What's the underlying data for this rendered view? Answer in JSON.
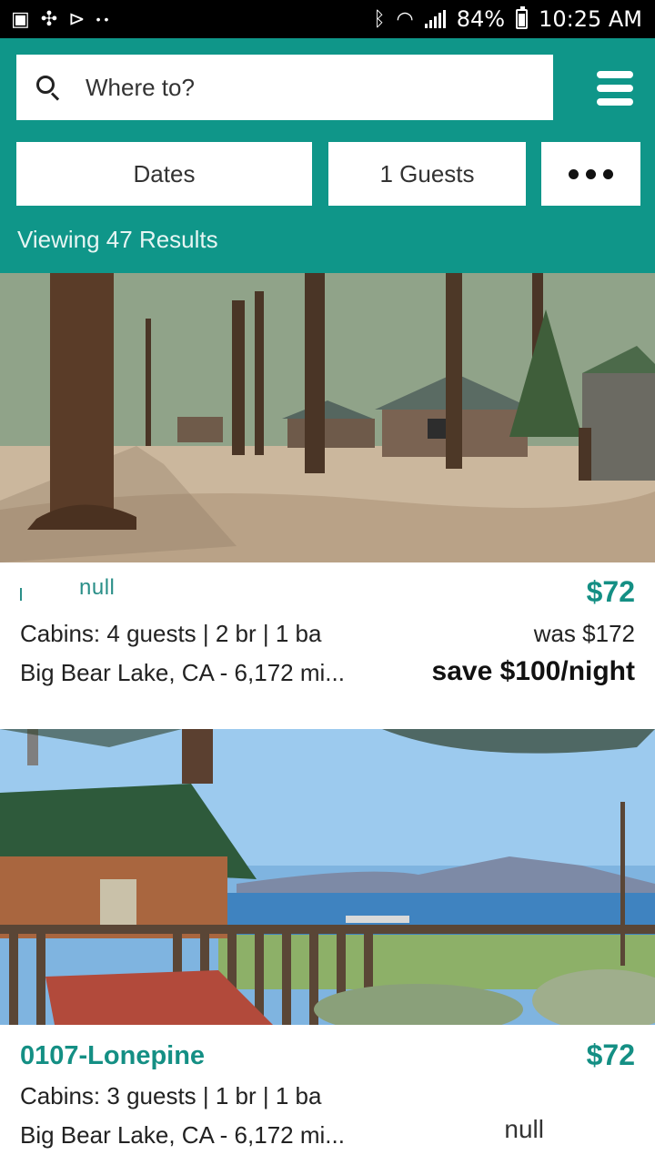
{
  "status_bar": {
    "left_icons": [
      "image-icon",
      "fan-icon",
      "play-icon",
      "dots-icon"
    ],
    "battery_percent": "84%",
    "time": "10:25 AM"
  },
  "header": {
    "search": {
      "placeholder": "Where to?"
    },
    "filters": {
      "dates_label": "Dates",
      "guests_label": "1 Guests",
      "more_label": "•••"
    },
    "results_text": "Viewing 47 Results",
    "background_color": "#0f9689"
  },
  "listings": [
    {
      "title": "null",
      "price": "$72",
      "meta": "Cabins: 4 guests | 2 br | 1 ba",
      "location": "Big Bear Lake, CA - 6,172 mi...",
      "was_price": "was $172",
      "savings": "save $100/night",
      "photo": "cabins-among-pine-trees"
    },
    {
      "title": "0107-Lonepine",
      "price": "$72",
      "meta": "Cabins: 3 guests | 1 br | 1 ba",
      "location": "Big Bear Lake, CA - 6,172 mi...",
      "extra": "null",
      "photo": "cabin-deck-lake-view"
    }
  ]
}
